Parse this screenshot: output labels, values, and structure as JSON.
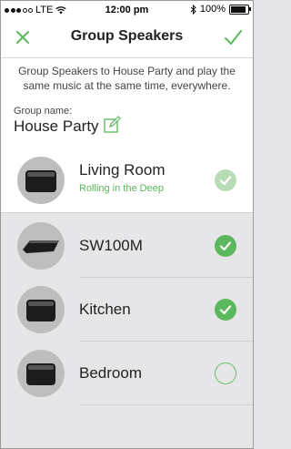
{
  "status_bar": {
    "carrier": "LTE",
    "time": "12:00 pm",
    "battery_label": "100%",
    "battery_level": 1.0
  },
  "nav": {
    "title": "Group Speakers",
    "close_icon": "close-icon",
    "confirm_icon": "checkmark-icon"
  },
  "description": "Group Speakers to House Party and play the same music at the same time, everywhere.",
  "group_name": {
    "label": "Group name:",
    "value": "House Party",
    "edit_icon": "edit-icon"
  },
  "speakers": [
    {
      "name": "Living Room",
      "subtitle": "Rolling in the Deep",
      "state": "selected-disabled"
    },
    {
      "name": "SW100M",
      "subtitle": "",
      "state": "selected"
    },
    {
      "name": "Kitchen",
      "subtitle": "",
      "state": "selected"
    },
    {
      "name": "Bedroom",
      "subtitle": "",
      "state": "unselected"
    }
  ],
  "colors": {
    "accent": "#5cb85c",
    "background": "#e6e6e9"
  }
}
